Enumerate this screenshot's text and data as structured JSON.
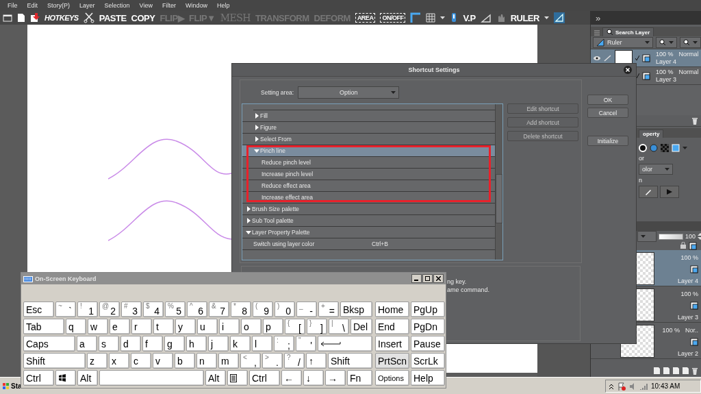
{
  "menu": [
    "File",
    "Edit",
    "Story(P)",
    "Layer",
    "Selection",
    "View",
    "Filter",
    "Window",
    "Help"
  ],
  "toolbar": [
    {
      "kind": "icon"
    },
    {
      "kind": "icon"
    },
    {
      "kind": "icon"
    },
    {
      "kind": "italic",
      "label": "HOTKEYS",
      "disabled": false
    },
    {
      "kind": "icon"
    },
    {
      "kind": "text",
      "label": "PASTE",
      "disabled": false
    },
    {
      "kind": "text",
      "label": "COPY",
      "disabled": false
    },
    {
      "kind": "text",
      "label": "FLIP▶",
      "disabled": true
    },
    {
      "kind": "text",
      "label": "FLIP▼",
      "disabled": true
    },
    {
      "kind": "light",
      "label": "MESH",
      "disabled": true
    },
    {
      "kind": "text",
      "label": "TRANSFORM",
      "disabled": true
    },
    {
      "kind": "text",
      "label": "DEFORM",
      "disabled": true
    },
    {
      "kind": "boxed",
      "label": "AREA",
      "disabled": false
    },
    {
      "kind": "boxed",
      "label": "ON/OFF",
      "disabled": false
    },
    {
      "kind": "icon"
    },
    {
      "kind": "icon"
    },
    {
      "kind": "icon"
    },
    {
      "kind": "icon"
    },
    {
      "kind": "text",
      "label": "V.P",
      "disabled": false
    },
    {
      "kind": "icon"
    },
    {
      "kind": "icon"
    },
    {
      "kind": "text",
      "label": "RULER",
      "disabled": false
    },
    {
      "kind": "icon"
    },
    {
      "kind": "icon"
    }
  ],
  "panel_toggle": "»",
  "layer_palette": {
    "tab": "Search Layer",
    "ruler_dropdown": "Ruler",
    "layers": [
      {
        "opacity": "100 %",
        "blend": "Normal",
        "name": "Layer 4",
        "selected": true
      },
      {
        "opacity": "100 %",
        "blend": "Normal",
        "name": "Layer 3",
        "selected": false
      }
    ]
  },
  "property_palette": {
    "tab": "operty",
    "label_1": "or",
    "dropdown": "olor",
    "label_2": "n"
  },
  "layer_list": {
    "opacity": "100",
    "opacity_slider": {
      "level": 1
    },
    "layers": [
      {
        "opacity": "100 %",
        "name": "Layer 4",
        "selected": true
      },
      {
        "opacity": "100 %",
        "name": "Layer 3",
        "selected": false
      },
      {
        "opacity": "100 %",
        "blend": "Nor..",
        "name": "Layer 2",
        "selected": false
      }
    ]
  },
  "dialog": {
    "title": "Shortcut Settings",
    "setting_area_label": "Setting area:",
    "setting_area": "Option",
    "tree": [
      {
        "children": [
          {
            "label": "Fill",
            "expanded": false,
            "selected": false,
            "highlighted": false
          },
          {
            "label": "Figure",
            "expanded": false,
            "selected": false,
            "highlighted": false
          },
          {
            "label": "Select From",
            "expanded": false,
            "selected": false,
            "highlighted": false
          },
          {
            "label": "Pinch line",
            "expanded": true,
            "selected": true,
            "highlighted": true,
            "children": [
              {
                "label": "Reduce pinch level",
                "selected": false,
                "highlighted": false
              },
              {
                "label": "Increase pinch level",
                "selected": false,
                "highlighted": false
              },
              {
                "label": "Reduce effect area",
                "selected": false,
                "highlighted": false
              },
              {
                "label": "Increase effect area",
                "selected": false,
                "highlighted": false
              }
            ]
          }
        ]
      },
      {
        "label": "Brush Size palette",
        "expanded": false,
        "selected": false,
        "highlighted": false
      },
      {
        "label": "Sub Tool palette",
        "expanded": false,
        "selected": false,
        "highlighted": false
      },
      {
        "label": "Layer Property Palette",
        "expanded": true,
        "selected": false,
        "highlighted": false,
        "children": [
          {
            "label": "Switch using layer color",
            "shortcut": "Ctrl+B",
            "selected": false,
            "highlighted": false
          }
        ]
      }
    ],
    "actions": [
      {
        "label": "Edit shortcut",
        "disabled": true
      },
      {
        "label": "Add shortcut",
        "disabled": true
      },
      {
        "label": "Delete shortcut",
        "disabled": true
      }
    ],
    "buttons": [
      {
        "label": "OK",
        "kind": "main"
      },
      {
        "label": "Cancel",
        "kind": "main"
      },
      {
        "label": "Initialize",
        "kind": "extra"
      }
    ],
    "info_lines": [
      "ng key.",
      "ame command."
    ]
  },
  "keyboard": {
    "title": "On-Screen Keyboard",
    "rows": [
      {
        "keys": [
          {
            "kind": "mod",
            "label": "Esc"
          },
          {
            "kind": "std",
            "shift": "~",
            "label": "`"
          },
          {
            "kind": "std",
            "shift": "!",
            "label": "1"
          },
          {
            "kind": "std",
            "shift": "@",
            "label": "2"
          },
          {
            "kind": "std",
            "shift": "#",
            "label": "3"
          },
          {
            "kind": "std",
            "shift": "$",
            "label": "4"
          },
          {
            "kind": "std",
            "shift": "%",
            "label": "5"
          },
          {
            "kind": "std",
            "shift": "^",
            "label": "6"
          },
          {
            "kind": "std",
            "shift": "&",
            "label": "7"
          },
          {
            "kind": "std",
            "shift": "*",
            "label": "8"
          },
          {
            "kind": "std",
            "shift": "(",
            "label": "9"
          },
          {
            "kind": "std",
            "shift": ")",
            "label": "0"
          },
          {
            "kind": "std",
            "shift": "_",
            "label": "-"
          },
          {
            "kind": "std",
            "shift": "+",
            "label": "="
          },
          {
            "kind": "fill",
            "label": "Bksp"
          }
        ]
      },
      {
        "keys": [
          {
            "kind": "tab",
            "label": "Tab"
          },
          {
            "kind": "std",
            "label": "q"
          },
          {
            "kind": "std",
            "label": "w"
          },
          {
            "kind": "std",
            "label": "e"
          },
          {
            "kind": "std",
            "label": "r"
          },
          {
            "kind": "std",
            "label": "t"
          },
          {
            "kind": "std",
            "label": "y"
          },
          {
            "kind": "std",
            "label": "u"
          },
          {
            "kind": "std",
            "label": "i"
          },
          {
            "kind": "std",
            "label": "o"
          },
          {
            "kind": "std",
            "label": "p"
          },
          {
            "kind": "std",
            "shift": "{",
            "label": "["
          },
          {
            "kind": "std",
            "shift": "}",
            "label": "]"
          },
          {
            "kind": "std",
            "shift": "|",
            "label": "\\"
          },
          {
            "kind": "fill",
            "label": "Del"
          }
        ]
      },
      {
        "keys": [
          {
            "kind": "caps",
            "label": "Caps"
          },
          {
            "kind": "std",
            "label": "a"
          },
          {
            "kind": "std",
            "label": "s"
          },
          {
            "kind": "std",
            "label": "d"
          },
          {
            "kind": "std",
            "label": "f"
          },
          {
            "kind": "std",
            "label": "g"
          },
          {
            "kind": "std",
            "label": "h"
          },
          {
            "kind": "std",
            "label": "j"
          },
          {
            "kind": "std",
            "label": "k"
          },
          {
            "kind": "std",
            "label": "l"
          },
          {
            "kind": "std",
            "shift": ":",
            "label": ";"
          },
          {
            "kind": "std",
            "shift": "\"",
            "label": "'"
          },
          {
            "kind": "enter"
          }
        ]
      },
      {
        "keys": [
          {
            "kind": "shift",
            "label": "Shift"
          },
          {
            "kind": "std",
            "label": "z"
          },
          {
            "kind": "std",
            "label": "x"
          },
          {
            "kind": "std",
            "label": "c"
          },
          {
            "kind": "std",
            "label": "v"
          },
          {
            "kind": "std",
            "label": "b"
          },
          {
            "kind": "std",
            "label": "n"
          },
          {
            "kind": "std",
            "label": "m"
          },
          {
            "kind": "std",
            "shift": "<",
            "label": ","
          },
          {
            "kind": "std",
            "shift": ">",
            "label": "."
          },
          {
            "kind": "std",
            "shift": "?",
            "label": "/"
          },
          {
            "kind": "std",
            "label": "↑"
          },
          {
            "kind": "fill",
            "label": "Shift"
          }
        ]
      },
      {
        "keys": [
          {
            "kind": "mod",
            "label": "Ctrl"
          },
          {
            "kind": "winkey"
          },
          {
            "kind": "std",
            "label": "Alt"
          },
          {
            "kind": "space"
          },
          {
            "kind": "std",
            "label": "Alt"
          },
          {
            "kind": "menukey"
          },
          {
            "kind": "mod",
            "label": "Ctrl"
          },
          {
            "kind": "std",
            "label": "←"
          },
          {
            "kind": "std",
            "label": "↓"
          },
          {
            "kind": "std",
            "label": "→"
          },
          {
            "kind": "fill",
            "label": "Fn"
          }
        ]
      }
    ],
    "nav_keys": [
      [
        {
          "label": "Home",
          "kind": "std",
          "pressed": false
        },
        {
          "label": "PgUp",
          "kind": "std",
          "pressed": false
        }
      ],
      [
        {
          "label": "End",
          "kind": "std",
          "pressed": false
        },
        {
          "label": "PgDn",
          "kind": "std",
          "pressed": false
        }
      ],
      [
        {
          "label": "Insert",
          "kind": "std",
          "pressed": false
        },
        {
          "label": "Pause",
          "kind": "std",
          "pressed": false
        }
      ],
      [
        {
          "label": "PrtScn",
          "kind": "std",
          "pressed": true
        },
        {
          "label": "ScrLk",
          "kind": "std",
          "pressed": false
        }
      ],
      [
        {
          "label": "Options",
          "kind": "small",
          "pressed": false
        },
        {
          "label": "Help",
          "kind": "std",
          "pressed": false
        }
      ]
    ]
  },
  "taskbar": {
    "start": "Sta",
    "clock": "10:43 AM"
  }
}
